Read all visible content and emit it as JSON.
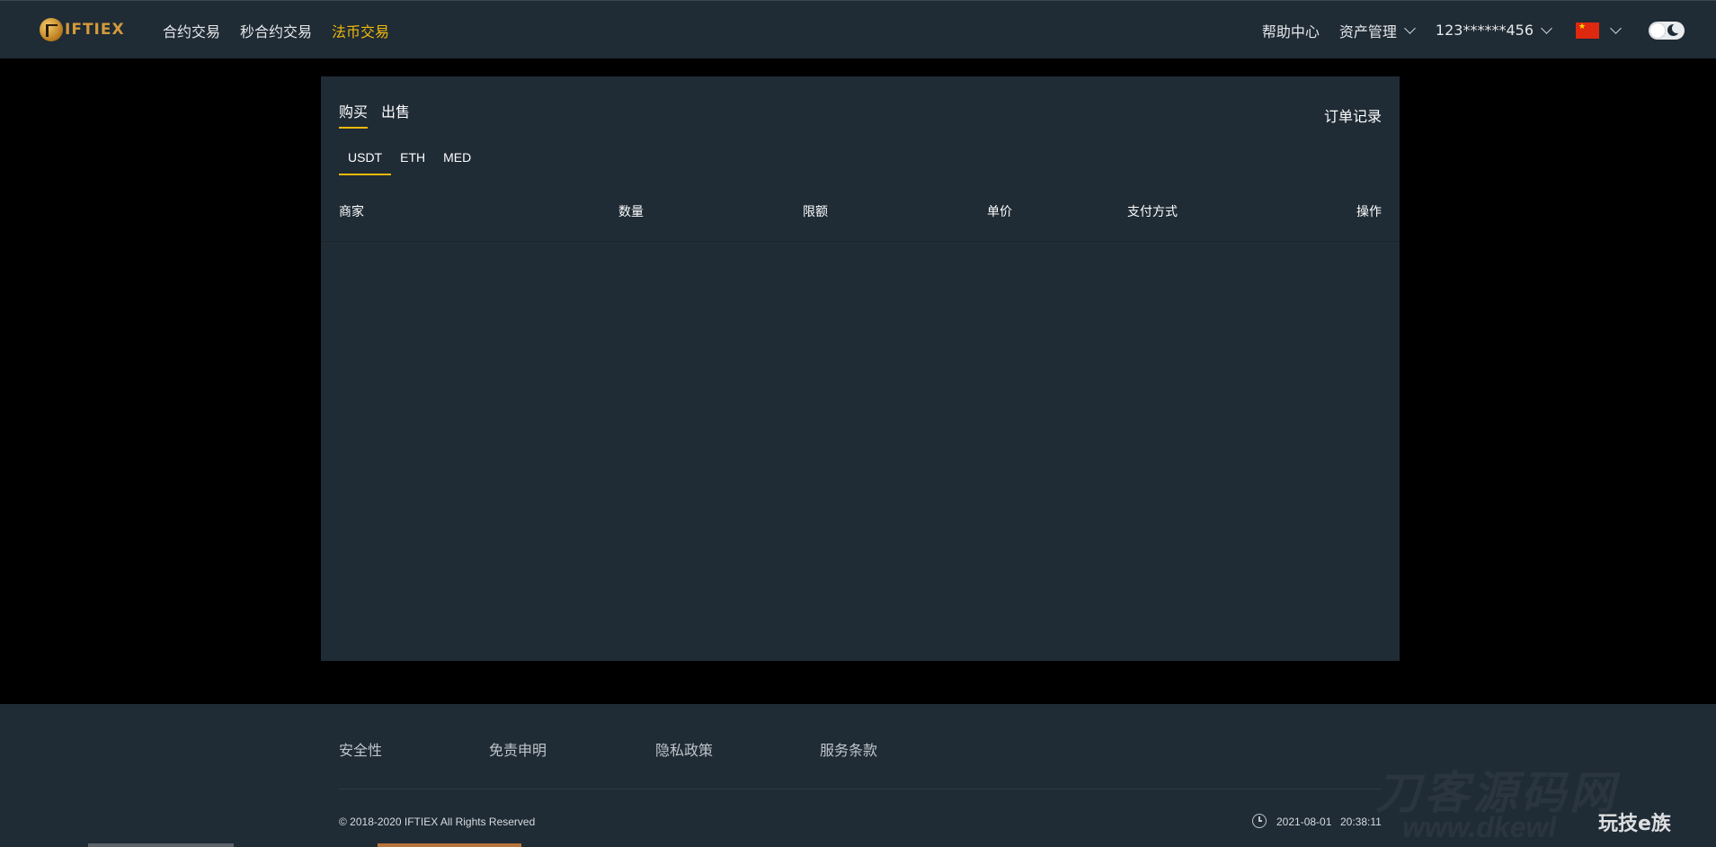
{
  "brand": {
    "logo_text": "IFTIEX",
    "accent_color": "#f0b90b"
  },
  "nav": {
    "items": [
      {
        "label": "合约交易",
        "active": false
      },
      {
        "label": "秒合约交易",
        "active": false
      },
      {
        "label": "法币交易",
        "active": true
      }
    ]
  },
  "header_right": {
    "help": "帮助中心",
    "assets": "资产管理",
    "account": "123******456",
    "language_icon": "china-flag-icon",
    "theme_toggle_icon": "moon-icon"
  },
  "trade": {
    "tabs": [
      {
        "label": "购买",
        "active": true
      },
      {
        "label": "出售",
        "active": false
      }
    ],
    "order_record": "订单记录",
    "coins": [
      {
        "label": "USDT",
        "active": true
      },
      {
        "label": "ETH",
        "active": false
      },
      {
        "label": "MED",
        "active": false
      }
    ],
    "columns": [
      "商家",
      "数量",
      "限额",
      "单价",
      "支付方式",
      "操作"
    ],
    "rows": []
  },
  "footer": {
    "links": [
      "安全性",
      "免责申明",
      "隐私政策",
      "服务条款"
    ],
    "copyright": "© 2018-2020 IFTIEX All Rights Reserved",
    "date": "2021-08-01",
    "time": "20:38:11"
  },
  "watermark": {
    "big": "刀客源码网",
    "url": "www.dkewl",
    "small": "玩技e族"
  }
}
